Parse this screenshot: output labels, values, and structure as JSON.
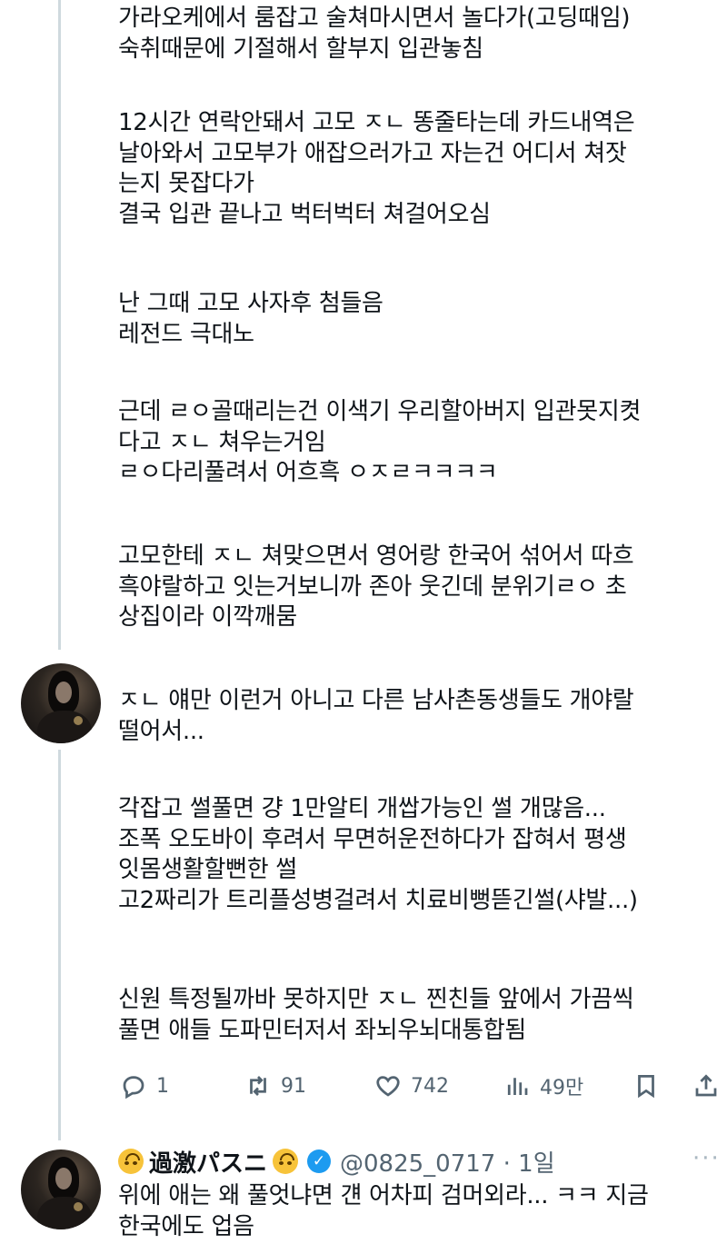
{
  "post1": {
    "paragraphs": [
      "가라오케에서 룸잡고 술쳐마시면서 놀다가(고딩때임)\n숙취때문에 기절해서 할부지 입관놓침",
      "12시간 연락안돼서 고모 ㅈㄴ 똥줄타는데 카드내역은\n날아와서 고모부가 애잡으러가고 자는건 어디서 쳐잣\n는지 못잡다가\n결국 입관 끝나고 벅터벅터 쳐걸어오심",
      "난 그때 고모 사자후 첨들음\n레전드 극대노",
      "근데 ㄹㅇ골때리는건 이색기 우리할아버지 입관못지켯\n다고 ㅈㄴ 쳐우는거임\nㄹㅇ다리풀려서 어흐흑 ㅇㅈㄹㅋㅋㅋㅋ",
      "고모한테 ㅈㄴ 쳐맞으면서 영어랑 한국어 섞어서 따흐\n흑야랄하고 잇는거보니까 존아 웃긴데 분위기ㄹㅇ 초\n상집이라 이깍깨뭄"
    ]
  },
  "post2": {
    "paragraphs": [
      "ㅈㄴ 얘만 이런거 아니고 다른 남사촌동생들도 개야랄\n떨어서...",
      "각잡고 썰풀면 걍 1만알티 개쌉가능인 썰 개많음...\n조폭 오도바이 후려서 무면허운전하다가 잡혀서 평생\n잇몸생활할뻔한 썰\n고2짜리가 트리플성병걸려서 치료비뻥뜯긴썰(샤발...)",
      "신원 특정될까바 못하지만 ㅈㄴ 찐친들 앞에서 가끔씩\n풀면 애들 도파민터저서 좌뇌우뇌대통합됨"
    ],
    "actions": {
      "reply_count": "1",
      "retweet_count": "91",
      "like_count": "742",
      "views_count": "49만"
    }
  },
  "post3": {
    "display_name": "過激パスニ",
    "handle_time": "@0825_0717 · 1일",
    "verified_mark": "✓",
    "more_label": "···",
    "body": "위에 애는 왜 풀엇냐면 걘 어차피 검머외라... ㅋㅋ 지금\n한국에도 업음"
  },
  "colors": {
    "text": "#0f1419",
    "muted": "#536471",
    "thread_line": "#cfd9de",
    "verified": "#1d9bf0"
  },
  "icons": [
    "reply-icon",
    "retweet-icon",
    "like-icon",
    "views-icon",
    "bookmark-icon",
    "share-icon",
    "verified-icon",
    "more-icon"
  ]
}
